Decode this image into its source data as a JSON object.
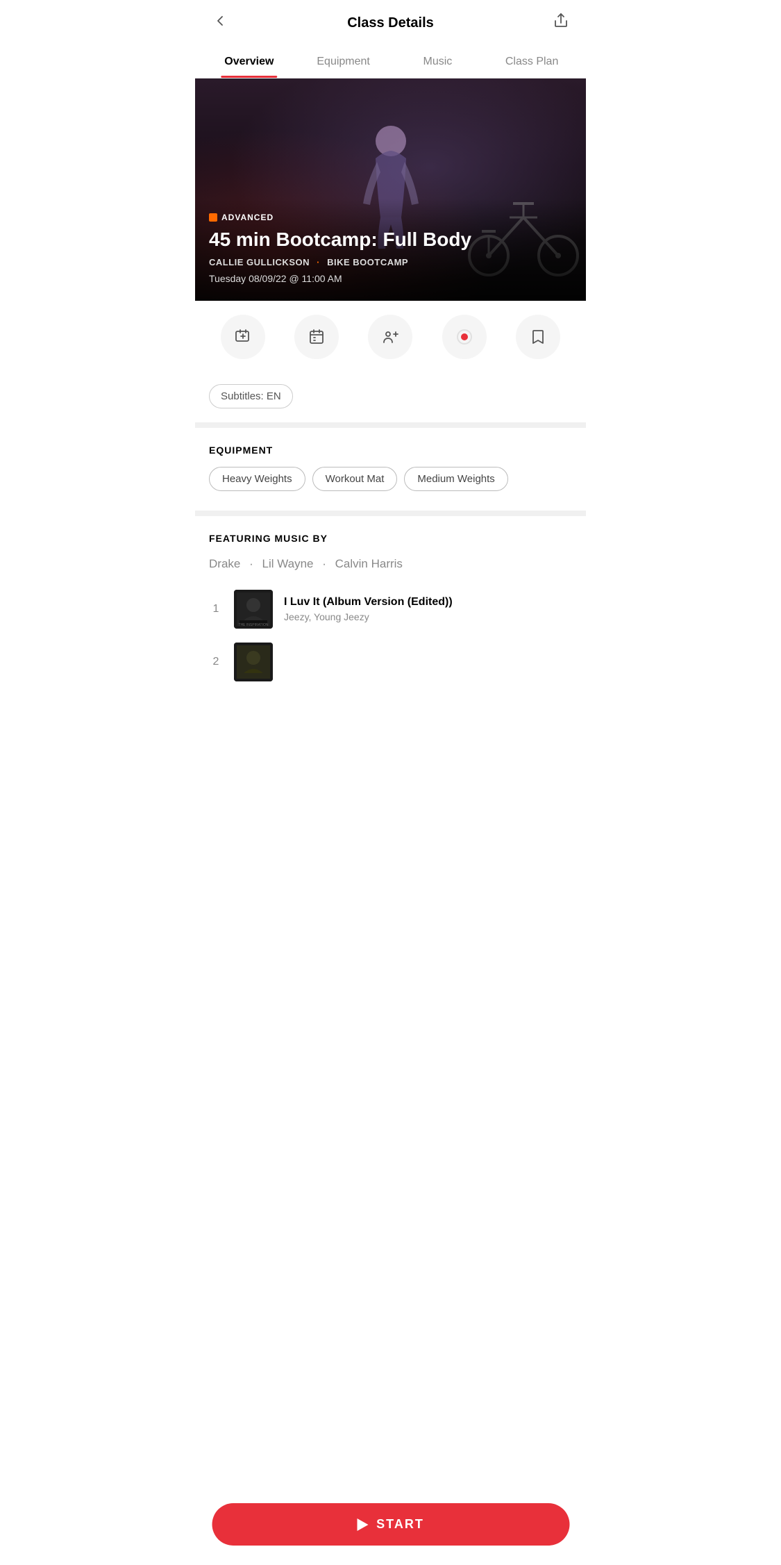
{
  "header": {
    "title": "Class Details",
    "back_label": "‹",
    "share_label": "↑"
  },
  "tabs": [
    {
      "label": "Overview",
      "active": true
    },
    {
      "label": "Equipment",
      "active": false
    },
    {
      "label": "Music",
      "active": false
    },
    {
      "label": "Class Plan",
      "active": false
    }
  ],
  "hero": {
    "badge": "ADVANCED",
    "title": "45 min Bootcamp: Full Body",
    "instructor": "CALLIE GULLICKSON",
    "class_type": "BIKE BOOTCAMP",
    "date": "Tuesday 08/09/22 @ 11:00 AM"
  },
  "actions": [
    {
      "name": "add-to-stack",
      "label": "Add to Stack"
    },
    {
      "name": "schedule",
      "label": "Schedule"
    },
    {
      "name": "invite-friends",
      "label": "Invite Friends"
    },
    {
      "name": "record",
      "label": "Record"
    },
    {
      "name": "bookmark",
      "label": "Bookmark"
    }
  ],
  "subtitles": {
    "label": "Subtitles: EN"
  },
  "equipment": {
    "section_title": "EQUIPMENT",
    "items": [
      "Heavy Weights",
      "Workout Mat",
      "Medium Weights"
    ]
  },
  "music": {
    "section_title": "FEATURING MUSIC BY",
    "artists": [
      "Drake",
      "Lil Wayne",
      "Calvin Harris"
    ],
    "tracks": [
      {
        "number": "1",
        "title": "I Luv It (Album Version (Edited))",
        "artist": "Jeezy, Young Jeezy",
        "has_art": true
      },
      {
        "number": "2",
        "title": "",
        "artist": "",
        "has_art": true
      }
    ]
  },
  "start_button": {
    "label": "START"
  }
}
